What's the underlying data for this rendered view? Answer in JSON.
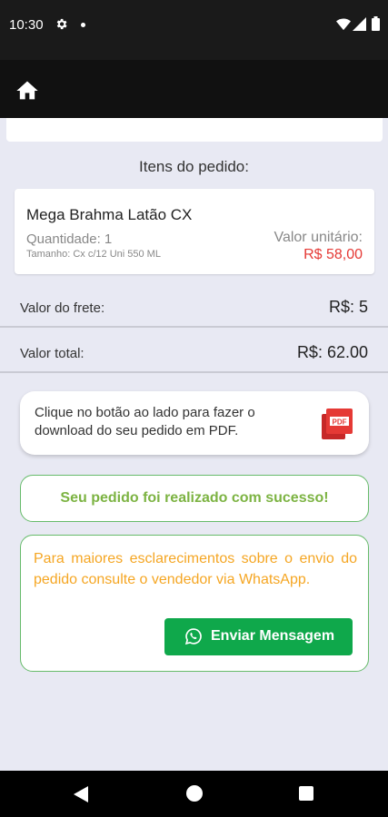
{
  "status_bar": {
    "time": "10:30"
  },
  "icons": {
    "gear": "gear-icon",
    "wifi": "wifi-icon",
    "signal": "signal-icon",
    "battery": "battery-icon",
    "home": "home-icon",
    "pdf": "pdf-icon",
    "whatsapp": "whatsapp-icon"
  },
  "order": {
    "items_title": "Itens do pedido:",
    "item": {
      "name": "Mega Brahma Latão CX",
      "quantity": "Quantidade: 1",
      "size": "Tamanho: Cx c/12 Uni 550 ML",
      "unit_label": "Valor unitário:",
      "unit_price": "R$ 58,00"
    },
    "freight_label": "Valor do frete:",
    "freight_value": "R$: 5",
    "total_label": "Valor total:",
    "total_value": "R$: 62.00"
  },
  "pdf": {
    "text": "Clique no botão ao lado para fazer o download do seu pedido em PDF."
  },
  "success": {
    "text": "Seu pedido foi realizado com sucesso!"
  },
  "info": {
    "text": "Para maiores esclarecimentos sobre o envio do pedido consulte o vendedor via WhatsApp.",
    "button_label": "Enviar Mensagem"
  },
  "colors": {
    "price_red": "#e53935",
    "success_green": "#7cb342",
    "info_orange": "#f5a623",
    "whatsapp_green": "#0fa84b",
    "border_green": "#66bb6a"
  }
}
